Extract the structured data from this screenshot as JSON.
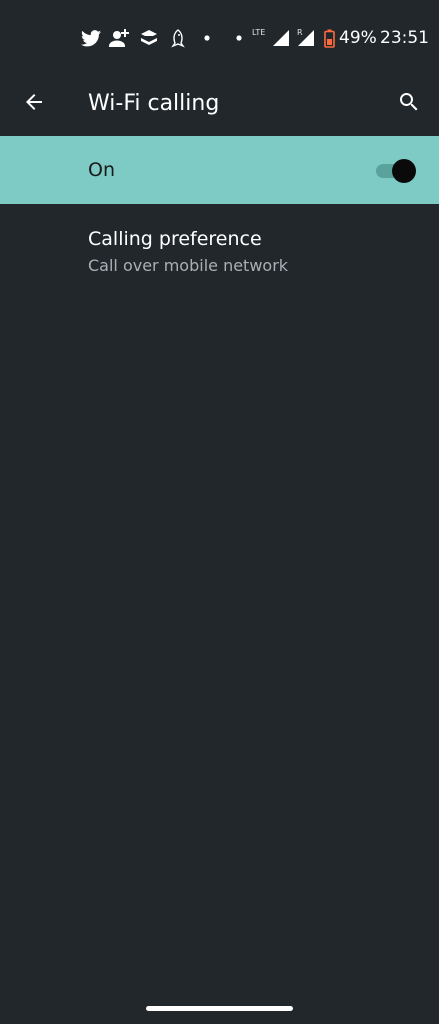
{
  "status_bar": {
    "battery_percent": "49%",
    "time": "23:51",
    "network_type": "LTE",
    "roaming_indicator": "R",
    "icons": [
      "twitter-icon",
      "person-add-icon",
      "app-logo-icon",
      "bird-icon",
      "dot-icon",
      "dot-icon",
      "signal-icon",
      "signal-roaming-icon",
      "battery-icon"
    ]
  },
  "app_bar": {
    "title": "Wi-Fi calling",
    "back_icon": "arrow-back-icon",
    "search_icon": "search-icon"
  },
  "master_switch": {
    "label": "On",
    "checked": true
  },
  "preferences": [
    {
      "title": "Calling preference",
      "summary": "Call over mobile network"
    }
  ],
  "colors": {
    "background": "#21272b",
    "accent_row": "#7ecbc5",
    "battery_warning": "#ff6a3d"
  }
}
